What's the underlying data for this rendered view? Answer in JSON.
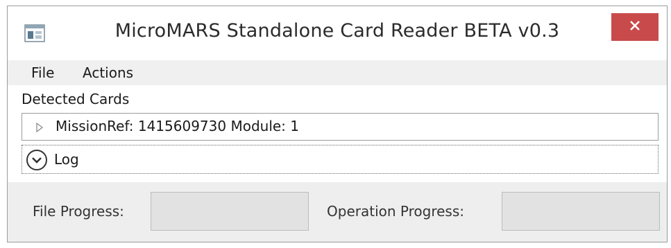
{
  "window": {
    "title": "MicroMARS Standalone Card Reader BETA v0.3",
    "icon": "application-icon",
    "close_icon": "close-icon"
  },
  "menu": {
    "items": [
      {
        "label": "File"
      },
      {
        "label": "Actions"
      }
    ]
  },
  "detected_cards": {
    "label": "Detected Cards",
    "items": [
      {
        "text": "MissionRef: 1415609730 Module: 1",
        "expanded": false
      }
    ]
  },
  "log": {
    "label": "Log",
    "expanded": false
  },
  "progress": {
    "file_label": "File Progress:",
    "file_value": 0,
    "operation_label": "Operation Progress:",
    "operation_value": 0
  },
  "colors": {
    "close_button": "#c94a4a",
    "window_background": "#ececec",
    "progress_background": "#e2e2e2"
  }
}
